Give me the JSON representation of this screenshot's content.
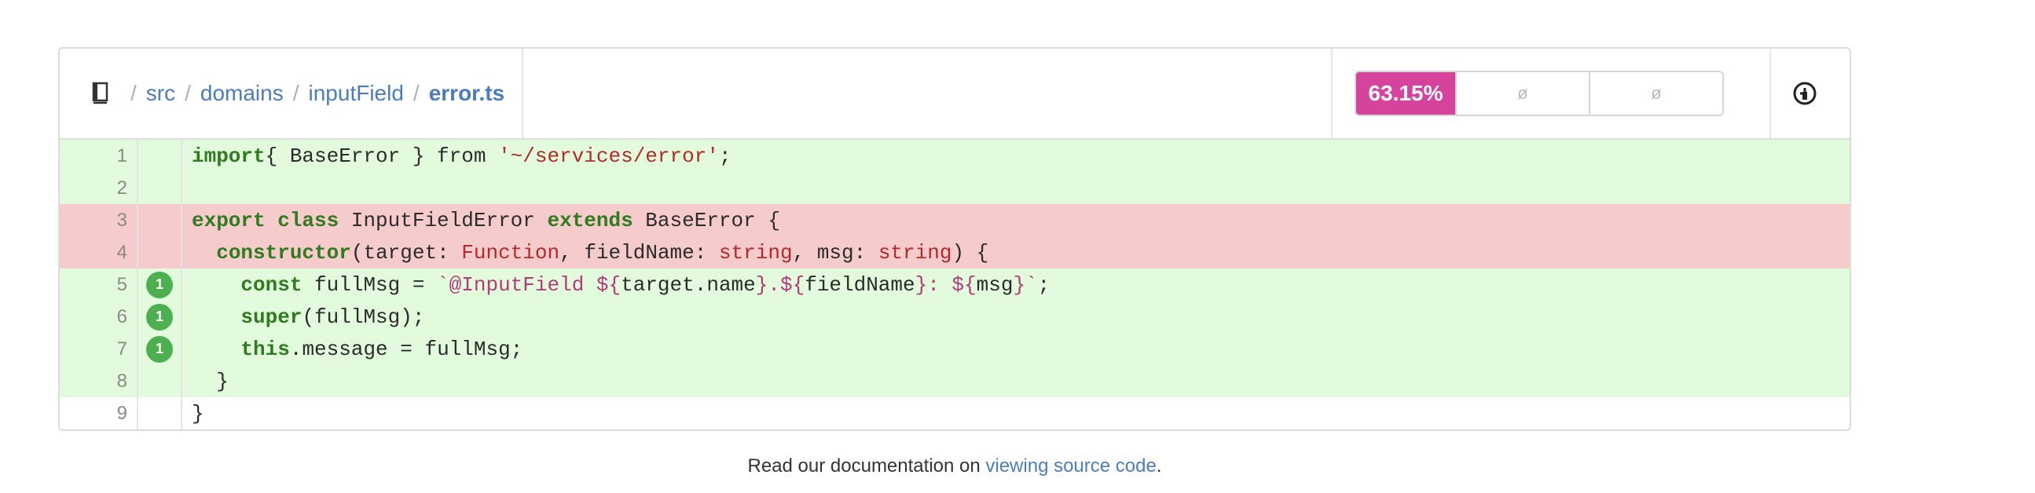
{
  "breadcrumb": {
    "icon": "book-icon",
    "items": [
      "src",
      "domains",
      "inputField"
    ],
    "file": "error.ts"
  },
  "coverage": {
    "percent": "63.15%",
    "empty1": "ø",
    "empty2": "ø",
    "accent": "#d5439c"
  },
  "history_icon": "history-icon",
  "lines": [
    {
      "n": "1",
      "status": "hit",
      "hits": "",
      "code": [
        [
          "kw",
          "import"
        ],
        [
          "",
          "{ BaseError } from "
        ],
        [
          "str",
          "'~/services/error'"
        ],
        [
          "",
          ";"
        ]
      ]
    },
    {
      "n": "2",
      "status": "hit",
      "hits": "",
      "code": []
    },
    {
      "n": "3",
      "status": "miss",
      "hits": "",
      "code": [
        [
          "kw",
          "export class"
        ],
        [
          "",
          " InputFieldError "
        ],
        [
          "kw",
          "extends"
        ],
        [
          "",
          " BaseError {"
        ]
      ]
    },
    {
      "n": "4",
      "status": "miss",
      "hits": "",
      "code": [
        [
          "",
          "  "
        ],
        [
          "kw",
          "constructor"
        ],
        [
          "",
          "(target: "
        ],
        [
          "typ",
          "Function"
        ],
        [
          "",
          ", fieldName: "
        ],
        [
          "typ",
          "string"
        ],
        [
          "",
          ", msg: "
        ],
        [
          "typ",
          "string"
        ],
        [
          "",
          ") {"
        ]
      ]
    },
    {
      "n": "5",
      "status": "hit",
      "hits": "1",
      "code": [
        [
          "",
          "    "
        ],
        [
          "kw",
          "const"
        ],
        [
          "",
          " fullMsg = "
        ],
        [
          "tpl",
          "`@InputField ${"
        ],
        [
          "",
          "target.name"
        ],
        [
          "tpl",
          "}.${"
        ],
        [
          "",
          "fieldName"
        ],
        [
          "tpl",
          "}: ${"
        ],
        [
          "",
          "msg"
        ],
        [
          "tpl",
          "}`"
        ],
        [
          "",
          ";"
        ]
      ]
    },
    {
      "n": "6",
      "status": "hit",
      "hits": "1",
      "code": [
        [
          "",
          "    "
        ],
        [
          "kw",
          "super"
        ],
        [
          "",
          "(fullMsg);"
        ]
      ]
    },
    {
      "n": "7",
      "status": "hit",
      "hits": "1",
      "code": [
        [
          "",
          "    "
        ],
        [
          "kw",
          "this"
        ],
        [
          "",
          ".message = fullMsg;"
        ]
      ]
    },
    {
      "n": "8",
      "status": "hit",
      "hits": "",
      "code": [
        [
          "",
          "  }"
        ]
      ]
    },
    {
      "n": "9",
      "status": "none",
      "hits": "",
      "code": [
        [
          "",
          "}"
        ]
      ]
    }
  ],
  "footer": {
    "text": "Read our documentation on ",
    "link": "viewing source code",
    "end": "."
  }
}
